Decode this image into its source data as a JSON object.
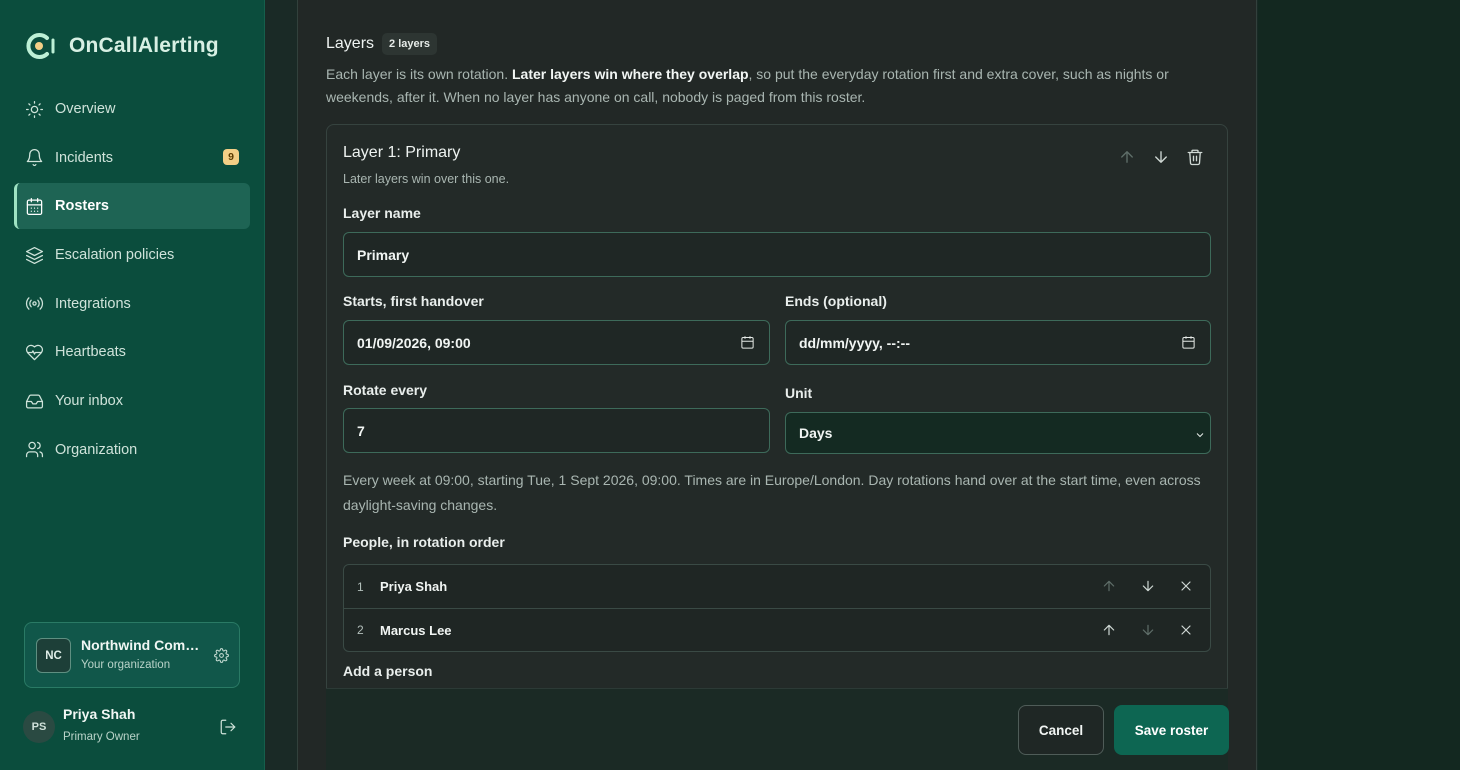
{
  "app": {
    "name": "OnCallAlerting"
  },
  "sidebar": {
    "items": [
      {
        "label": "Overview",
        "icon": "sun-icon"
      },
      {
        "label": "Incidents",
        "icon": "bell-icon",
        "badge": "9"
      },
      {
        "label": "Rosters",
        "icon": "calendar-icon",
        "active": true
      },
      {
        "label": "Escalation policies",
        "icon": "layers-icon"
      },
      {
        "label": "Integrations",
        "icon": "broadcast-icon"
      },
      {
        "label": "Heartbeats",
        "icon": "heart-pulse-icon"
      },
      {
        "label": "Your inbox",
        "icon": "inbox-icon"
      },
      {
        "label": "Organization",
        "icon": "users-icon"
      }
    ],
    "org": {
      "initials": "NC",
      "name": "Northwind Com…",
      "subtitle": "Your organization"
    },
    "user": {
      "initials": "PS",
      "name": "Priya Shah",
      "role": "Primary Owner"
    }
  },
  "layers": {
    "title": "Layers",
    "count": "2 layers",
    "desc_pre": "Each layer is its own rotation. ",
    "desc_bold": "Later layers win where they overlap",
    "desc_post": ", so put the everyday rotation first and extra cover, such as nights or weekends, after it. When no layer has anyone on call, nobody is paged from this roster."
  },
  "layer": {
    "title": "Layer 1: Primary",
    "subtitle": "Later layers win over this one.",
    "name_label": "Layer name",
    "name_value": "Primary",
    "starts_label": "Starts, first handover",
    "starts_value": "01/09/2026, 09:00",
    "ends_label": "Ends (optional)",
    "ends_value": "dd/mm/yyyy, --:--",
    "rotate_label": "Rotate every",
    "rotate_value": "7",
    "unit_label": "Unit",
    "unit_value": "Days",
    "note": "Every week at 09:00, starting Tue, 1 Sept 2026, 09:00. Times are in Europe/London. Day rotations hand over at the start time, even across daylight-saving changes.",
    "people_label": "People, in rotation order",
    "people": [
      {
        "num": "1",
        "name": "Priya Shah"
      },
      {
        "num": "2",
        "name": "Marcus Lee"
      }
    ],
    "add_person_label": "Add a person"
  },
  "footer": {
    "cancel": "Cancel",
    "save": "Save roster"
  },
  "colors": {
    "sidebar": "#0b4d3d",
    "accent": "#0d6652",
    "badge": "#f3cf86"
  }
}
